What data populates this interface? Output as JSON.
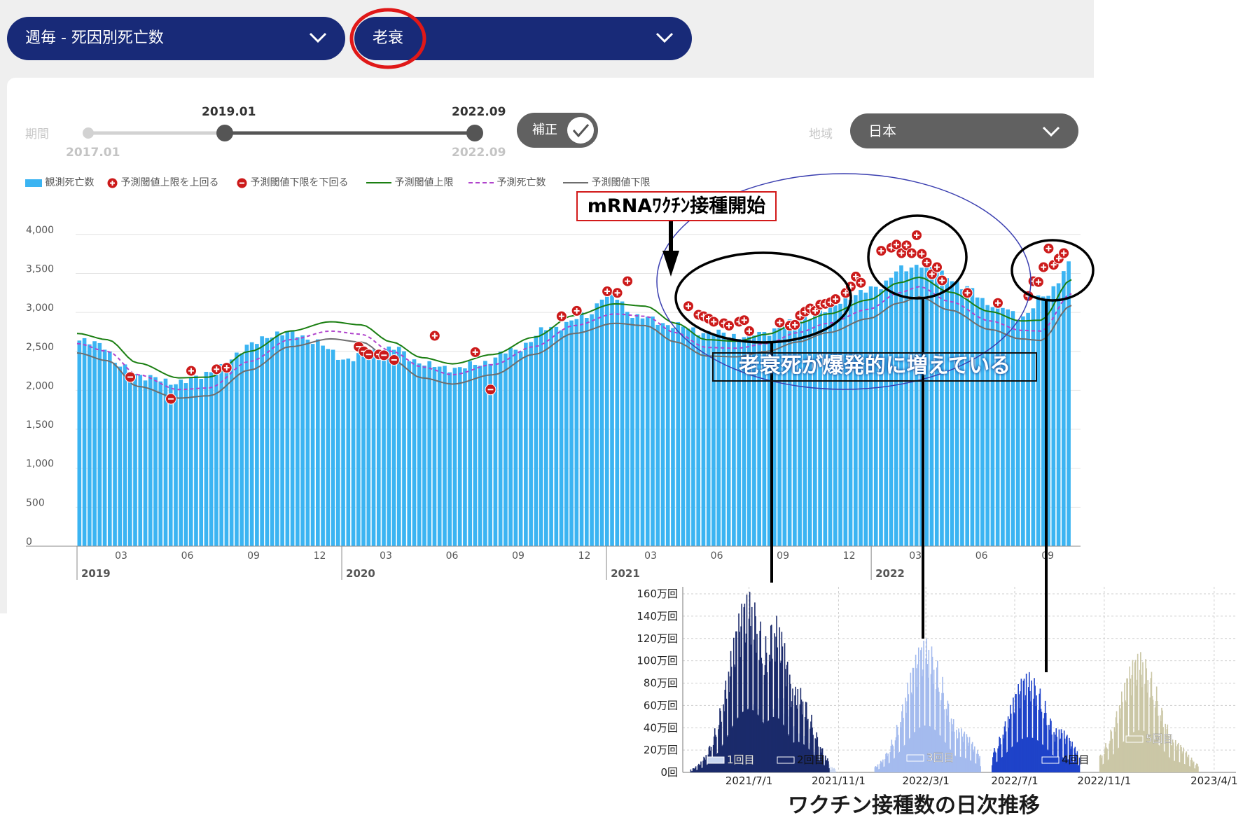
{
  "selectors": {
    "dataset_label": "週毎 - 死因別死亡数",
    "cause_label": "老衰",
    "region_label": "地域",
    "region_value": "日本",
    "correction_label": "補正"
  },
  "period": {
    "label": "期間",
    "min_label": "2017.01",
    "start_label": "2019.01",
    "end_label": "2022.09",
    "max_label": "2022.09"
  },
  "annotations": {
    "vaccine_start": "mRNAﾜｸﾁﾝ接種開始",
    "explosive_increase": "老衰死が爆発的に増えている",
    "inset_title": "ワクチン接種数の日次推移"
  },
  "colors": {
    "bar": "#3bb4f2",
    "upper_threshold": "#1b7f12",
    "expected": "#b044cc",
    "lower_threshold": "#6e6e6e",
    "marker": "#cc1a1a",
    "pill": "#182a78",
    "dose1": "#c9d6f0",
    "dose2": "#1b2a6b",
    "dose3": "#a4bbee",
    "dose4": "#1f43c9",
    "dose5": "#cbc7a6",
    "circle_red": "#e01818",
    "ellipse_blue": "#3b3fb0"
  },
  "chart_data": [
    {
      "type": "bar",
      "title": "",
      "legend": [
        "観測死亡数",
        "予測閾値上限を上回る",
        "予測閾値下限を下回る",
        "予測閾値上限",
        "予測死亡数",
        "予測閾値下限"
      ],
      "legend_position": "top-left",
      "ylim": [
        0,
        4000
      ],
      "yticks": [
        "0",
        "500",
        "1,000",
        "1,500",
        "2,000",
        "2,500",
        "3,000",
        "3,500",
        "4,000"
      ],
      "grid": true,
      "x_start": "2019-01",
      "x_end": "2022-09",
      "weeks": 196,
      "month_ticks": [
        "03",
        "06",
        "09",
        "12"
      ],
      "month_ticks_2022": [
        "03",
        "06",
        "09"
      ],
      "year_labels": [
        "2019",
        "2020",
        "2021",
        "2022"
      ],
      "anchors_observed": [
        [
          0,
          2620
        ],
        [
          4,
          2620
        ],
        [
          8,
          2300
        ],
        [
          14,
          2150
        ],
        [
          20,
          2100
        ],
        [
          27,
          2260
        ],
        [
          34,
          2600
        ],
        [
          40,
          2750
        ],
        [
          46,
          2650
        ],
        [
          52,
          2400
        ],
        [
          57,
          2470
        ],
        [
          62,
          2550
        ],
        [
          66,
          2380
        ],
        [
          72,
          2280
        ],
        [
          78,
          2320
        ],
        [
          85,
          2500
        ],
        [
          93,
          2800
        ],
        [
          100,
          2950
        ],
        [
          104,
          3260
        ],
        [
          110,
          2950
        ],
        [
          116,
          2850
        ],
        [
          123,
          2750
        ],
        [
          130,
          2700
        ],
        [
          134,
          2720
        ],
        [
          140,
          2850
        ],
        [
          146,
          3000
        ],
        [
          152,
          3200
        ],
        [
          158,
          3350
        ],
        [
          162,
          3550
        ],
        [
          166,
          3620
        ],
        [
          170,
          3500
        ],
        [
          175,
          3300
        ],
        [
          180,
          3100
        ],
        [
          186,
          2950
        ],
        [
          190,
          3200
        ],
        [
          196,
          3650
        ]
      ],
      "anchors_upper": [
        [
          0,
          2730
        ],
        [
          6,
          2650
        ],
        [
          12,
          2350
        ],
        [
          20,
          2160
        ],
        [
          26,
          2170
        ],
        [
          34,
          2500
        ],
        [
          42,
          2760
        ],
        [
          50,
          2880
        ],
        [
          56,
          2840
        ],
        [
          62,
          2620
        ],
        [
          68,
          2420
        ],
        [
          74,
          2340
        ],
        [
          82,
          2460
        ],
        [
          90,
          2680
        ],
        [
          98,
          2960
        ],
        [
          106,
          3110
        ],
        [
          112,
          3080
        ],
        [
          118,
          2860
        ],
        [
          124,
          2650
        ],
        [
          130,
          2630
        ],
        [
          136,
          2720
        ],
        [
          142,
          2860
        ],
        [
          148,
          2980
        ],
        [
          156,
          3160
        ],
        [
          162,
          3380
        ],
        [
          166,
          3450
        ],
        [
          172,
          3260
        ],
        [
          180,
          3010
        ],
        [
          186,
          2890
        ],
        [
          190,
          2900
        ],
        [
          196,
          3420
        ]
      ],
      "anchors_expected": [
        [
          0,
          2600
        ],
        [
          6,
          2500
        ],
        [
          12,
          2200
        ],
        [
          20,
          2010
        ],
        [
          26,
          2030
        ],
        [
          34,
          2370
        ],
        [
          42,
          2650
        ],
        [
          50,
          2760
        ],
        [
          56,
          2720
        ],
        [
          62,
          2500
        ],
        [
          68,
          2300
        ],
        [
          74,
          2200
        ],
        [
          82,
          2330
        ],
        [
          90,
          2560
        ],
        [
          98,
          2830
        ],
        [
          106,
          2980
        ],
        [
          112,
          2950
        ],
        [
          118,
          2740
        ],
        [
          124,
          2550
        ],
        [
          130,
          2540
        ],
        [
          136,
          2600
        ],
        [
          142,
          2740
        ],
        [
          148,
          2860
        ],
        [
          156,
          3040
        ],
        [
          162,
          3250
        ],
        [
          166,
          3330
        ],
        [
          172,
          3140
        ],
        [
          180,
          2890
        ],
        [
          186,
          2770
        ],
        [
          190,
          2760
        ],
        [
          196,
          3240
        ]
      ],
      "anchors_lower": [
        [
          0,
          2480
        ],
        [
          6,
          2380
        ],
        [
          12,
          2050
        ],
        [
          20,
          1900
        ],
        [
          26,
          1930
        ],
        [
          34,
          2260
        ],
        [
          42,
          2560
        ],
        [
          50,
          2660
        ],
        [
          56,
          2620
        ],
        [
          62,
          2390
        ],
        [
          68,
          2160
        ],
        [
          74,
          2080
        ],
        [
          82,
          2200
        ],
        [
          90,
          2460
        ],
        [
          98,
          2730
        ],
        [
          106,
          2860
        ],
        [
          112,
          2830
        ],
        [
          118,
          2620
        ],
        [
          124,
          2440
        ],
        [
          130,
          2430
        ],
        [
          136,
          2500
        ],
        [
          142,
          2620
        ],
        [
          148,
          2740
        ],
        [
          156,
          2920
        ],
        [
          162,
          3120
        ],
        [
          166,
          3200
        ],
        [
          172,
          3030
        ],
        [
          180,
          2780
        ],
        [
          186,
          2660
        ],
        [
          190,
          2640
        ],
        [
          196,
          3090
        ]
      ],
      "above_upper_weeks": [
        [
          22,
          2250
        ],
        [
          27,
          2270
        ],
        [
          29,
          2290
        ],
        [
          70,
          2700
        ],
        [
          78,
          2490
        ],
        [
          95,
          2950
        ],
        [
          98,
          3020
        ],
        [
          104,
          3270
        ],
        [
          106,
          3250
        ],
        [
          108,
          3400
        ],
        [
          120,
          3080
        ],
        [
          122,
          2970
        ],
        [
          123,
          2950
        ],
        [
          124,
          2920
        ],
        [
          125,
          2880
        ],
        [
          127,
          2860
        ],
        [
          128,
          2830
        ],
        [
          130,
          2880
        ],
        [
          131,
          2900
        ],
        [
          132,
          2760
        ],
        [
          138,
          2870
        ],
        [
          140,
          2830
        ],
        [
          141,
          2840
        ],
        [
          142,
          2960
        ],
        [
          143,
          3010
        ],
        [
          144,
          3050
        ],
        [
          145,
          3020
        ],
        [
          146,
          3100
        ],
        [
          147,
          3110
        ],
        [
          148,
          3130
        ],
        [
          149,
          3170
        ],
        [
          151,
          3250
        ],
        [
          152,
          3330
        ],
        [
          153,
          3460
        ],
        [
          154,
          3380
        ],
        [
          158,
          3790
        ],
        [
          160,
          3830
        ],
        [
          161,
          3870
        ],
        [
          162,
          3760
        ],
        [
          163,
          3860
        ],
        [
          164,
          3760
        ],
        [
          165,
          3990
        ],
        [
          166,
          3750
        ],
        [
          167,
          3640
        ],
        [
          168,
          3490
        ],
        [
          169,
          3580
        ],
        [
          170,
          3410
        ],
        [
          175,
          3250
        ],
        [
          181,
          3120
        ],
        [
          187,
          3210
        ],
        [
          188,
          3400
        ],
        [
          189,
          3390
        ],
        [
          190,
          3580
        ],
        [
          191,
          3820
        ],
        [
          192,
          3610
        ],
        [
          193,
          3690
        ],
        [
          194,
          3760
        ]
      ],
      "below_lower_weeks": [
        [
          10,
          2170
        ],
        [
          18,
          1890
        ],
        [
          55,
          2560
        ],
        [
          56,
          2500
        ],
        [
          57,
          2460
        ],
        [
          59,
          2460
        ],
        [
          60,
          2450
        ],
        [
          62,
          2390
        ],
        [
          81,
          2010
        ]
      ]
    },
    {
      "type": "area",
      "title": "ワクチン接種数の日次推移",
      "ylim": [
        0,
        1600000
      ],
      "yticks": [
        "0回",
        "20万回",
        "40万回",
        "60万回",
        "80万回",
        "100万回",
        "120万回",
        "140万回",
        "160万回"
      ],
      "xticks": [
        "2021/7/1",
        "2021/11/1",
        "2022/3/1",
        "2022/7/1",
        "2022/11/1",
        "2023/4/1"
      ],
      "x_range": [
        "2021-04-01",
        "2023-05-01"
      ],
      "grid": true,
      "series": [
        {
          "name": "1回目",
          "peaks": [
            [
              "2021-07-10",
              620000
            ],
            [
              "2021-08-10",
              700000
            ],
            [
              "2021-09-10",
              350000
            ]
          ]
        },
        {
          "name": "2回目",
          "peaks": [
            [
              "2021-07-01",
              1620000
            ],
            [
              "2021-08-05",
              1420000
            ],
            [
              "2021-09-05",
              780000
            ]
          ]
        },
        {
          "name": "3回目",
          "peaks": [
            [
              "2022-03-01",
              1200000
            ],
            [
              "2022-04-15",
              400000
            ]
          ]
        },
        {
          "name": "4回目",
          "peaks": [
            [
              "2022-07-20",
              900000
            ],
            [
              "2022-08-30",
              400000
            ]
          ]
        },
        {
          "name": "5回目",
          "peaks": [
            [
              "2022-12-20",
              1080000
            ],
            [
              "2023-02-01",
              300000
            ]
          ]
        }
      ]
    }
  ]
}
